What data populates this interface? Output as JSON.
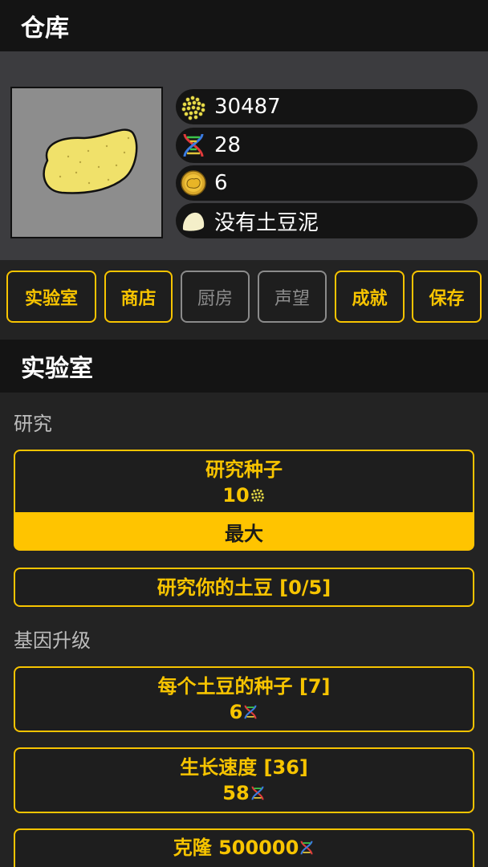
{
  "warehouse": {
    "title": "仓库"
  },
  "resources": {
    "seeds": {
      "icon": "seeds-icon",
      "value": "30487"
    },
    "dna": {
      "icon": "dna-icon",
      "value": "28"
    },
    "potatoes": {
      "icon": "potato-coin-icon",
      "value": "6"
    },
    "mash": {
      "icon": "mashed-potato-icon",
      "value": "没有土豆泥"
    }
  },
  "nav": {
    "lab": "实验室",
    "shop": "商店",
    "kitchen": "厨房",
    "reputation": "声望",
    "achievements": "成就",
    "save": "保存"
  },
  "lab": {
    "title": "实验室",
    "research": {
      "label": "研究",
      "research_seeds": {
        "label": "研究种子",
        "cost": "10",
        "cost_icon": "seeds-icon"
      },
      "max_label": "最大",
      "research_potato": {
        "label": "研究你的土豆 [0/5]"
      }
    },
    "gene": {
      "label": "基因升级",
      "seeds_per_potato": {
        "label": "每个土豆的种子 [7]",
        "cost": "6",
        "cost_icon": "dna-icon"
      },
      "growth_speed": {
        "label": "生长速度 [36]",
        "cost": "58",
        "cost_icon": "dna-icon"
      },
      "clone": {
        "label": "克隆 500000",
        "cost_icon": "dna-icon"
      }
    }
  },
  "colors": {
    "accent": "#f7c400",
    "max_button": "#ffc400",
    "background": "#232323",
    "header": "#141414",
    "panel": "#3c3c3f"
  }
}
